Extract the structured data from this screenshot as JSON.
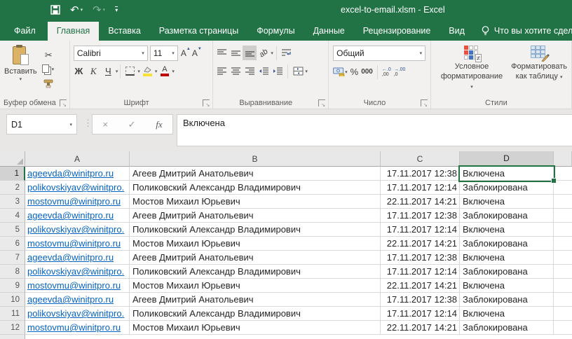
{
  "title_bar": {
    "title": "excel-to-email.xlsm - Excel"
  },
  "icons": {
    "save": "save-floppy",
    "undo": "↶",
    "redo": "↷",
    "dropdown": "▾",
    "cut": "✂",
    "close": "×",
    "check": "✓",
    "dots": "⋮",
    "not_equal": "≠",
    "arrow_left": "←",
    "arrow_right": "→",
    "inc_dec_left_top": "←.0",
    "inc_dec_left_bot": ",00",
    "inc_dec_right_top": "→.00",
    "inc_dec_right_bot": ",0"
  },
  "colors": {
    "accent_green": "#217346",
    "hyperlink": "#0563c1",
    "selection_border": "#217346"
  },
  "tabs": {
    "file": "Файл",
    "home": "Главная",
    "insert": "Вставка",
    "layout": "Разметка страницы",
    "formulas": "Формулы",
    "data": "Данные",
    "review": "Рецензирование",
    "view": "Вид",
    "tell_me": "Что вы хотите сделать"
  },
  "ribbon": {
    "clipboard": {
      "label": "Буфер обмена",
      "paste_label": "Вставить"
    },
    "font": {
      "label": "Шрифт",
      "family": "Calibri",
      "size": "11",
      "bold": "Ж",
      "italic": "К",
      "underline": "Ч",
      "letter": "А"
    },
    "alignment": {
      "label": "Выравнивание",
      "orientation": "ab"
    },
    "number": {
      "label": "Число",
      "format": "Общий",
      "percent": "%",
      "thousands": "000"
    },
    "styles": {
      "label": "Стили",
      "conditional_line1": "Условное",
      "conditional_line2": "форматирование",
      "table_line1": "Форматировать",
      "table_line2": "как таблицу"
    }
  },
  "formula_bar": {
    "name_box": "D1",
    "fx_label": "fx",
    "value": "Включена"
  },
  "sheet": {
    "columns": [
      "A",
      "B",
      "C",
      "D"
    ],
    "selected_cell": "D1",
    "rows": [
      {
        "n": "1",
        "email": "ageevda@winitpro.ru",
        "name": "Агеев Дмитрий Анатольевич",
        "date": "17.11.2017 12:38",
        "status": "Включена"
      },
      {
        "n": "2",
        "email": "polikovskiyav@winitpro.",
        "name": "Поликовский Александр Владимирович",
        "date": "17.11.2017 12:14",
        "status": "Заблокирована"
      },
      {
        "n": "3",
        "email": "mostovmu@winitpro.ru",
        "name": "Мостов Михаил Юрьевич",
        "date": "22.11.2017 14:21",
        "status": "Включена"
      },
      {
        "n": "4",
        "email": "ageevda@winitpro.ru",
        "name": "Агеев Дмитрий Анатольевич",
        "date": "17.11.2017 12:38",
        "status": "Заблокирована"
      },
      {
        "n": "5",
        "email": "polikovskiyav@winitpro.",
        "name": "Поликовский Александр Владимирович",
        "date": "17.11.2017 12:14",
        "status": "Включена"
      },
      {
        "n": "6",
        "email": "mostovmu@winitpro.ru",
        "name": "Мостов Михаил Юрьевич",
        "date": "22.11.2017 14:21",
        "status": "Заблокирована"
      },
      {
        "n": "7",
        "email": "ageevda@winitpro.ru",
        "name": "Агеев Дмитрий Анатольевич",
        "date": "17.11.2017 12:38",
        "status": "Включена"
      },
      {
        "n": "8",
        "email": "polikovskiyav@winitpro.",
        "name": "Поликовский Александр Владимирович",
        "date": "17.11.2017 12:14",
        "status": "Заблокирована"
      },
      {
        "n": "9",
        "email": "mostovmu@winitpro.ru",
        "name": "Мостов Михаил Юрьевич",
        "date": "22.11.2017 14:21",
        "status": "Включена"
      },
      {
        "n": "10",
        "email": "ageevda@winitpro.ru",
        "name": "Агеев Дмитрий Анатольевич",
        "date": "17.11.2017 12:38",
        "status": "Заблокирована"
      },
      {
        "n": "11",
        "email": "polikovskiyav@winitpro.",
        "name": "Поликовский Александр Владимирович",
        "date": "17.11.2017 12:14",
        "status": "Включена"
      },
      {
        "n": "12",
        "email": "mostovmu@winitpro.ru",
        "name": "Мостов Михаил Юрьевич",
        "date": "22.11.2017 14:21",
        "status": "Заблокирована"
      }
    ]
  }
}
